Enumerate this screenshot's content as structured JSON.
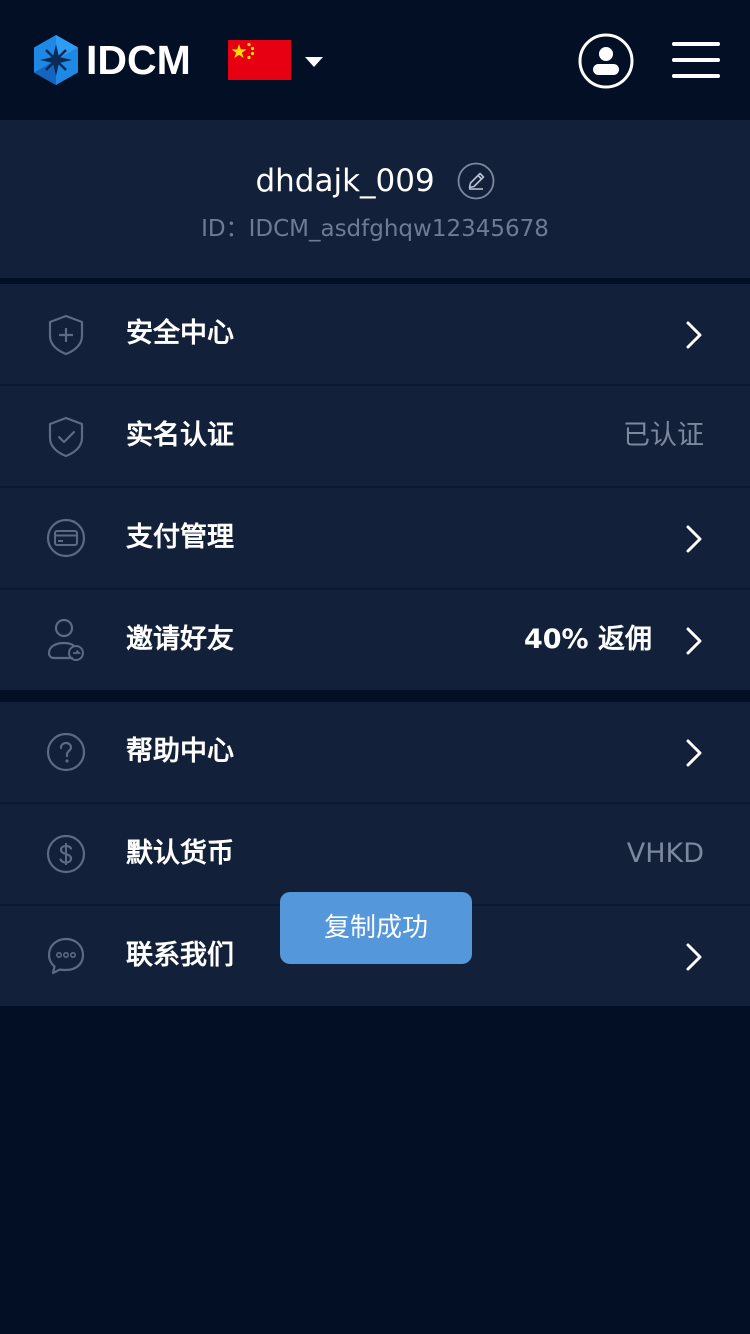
{
  "header": {
    "brand": "IDCM",
    "logo_icon": "hexagon-star-logo",
    "flag_icon": "china-flag-icon",
    "language_caret_icon": "caret-down-icon",
    "account_icon": "user-circle-icon",
    "menu_icon": "hamburger-menu-icon"
  },
  "profile": {
    "username": "dhdajk_009",
    "id_text": "ID：IDCM_asdfghqw12345678"
  },
  "menu_groups": [
    {
      "items": [
        {
          "label": "安全中心",
          "icon": "shield-plus-icon",
          "value": "",
          "chevron": true
        },
        {
          "label": "实名认证",
          "icon": "shield-check-icon",
          "value": "已认证",
          "chevron": false
        },
        {
          "label": "支付管理",
          "icon": "payment-card-icon",
          "value": "",
          "chevron": true
        },
        {
          "label": "邀请好友",
          "icon": "invite-user-icon",
          "value": "40% 返佣",
          "chevron": true
        }
      ]
    },
    {
      "items": [
        {
          "label": "帮助中心",
          "icon": "help-circle-icon",
          "value": "",
          "chevron": true
        },
        {
          "label": "默认货币",
          "icon": "dollar-circle-icon",
          "value": "VHKD",
          "chevron": false
        },
        {
          "label": "联系我们",
          "icon": "chat-bubble-icon",
          "value": "",
          "chevron": true
        }
      ]
    }
  ],
  "toast": {
    "text": "复制成功"
  },
  "colors": {
    "background": "#020f25",
    "panel": "#122039",
    "divider": "#0b1830",
    "muted_text": "#7c889e",
    "icon_stroke": "#5c6a83",
    "accent_blue": "#2d8cf0",
    "toast": "#5497db"
  }
}
